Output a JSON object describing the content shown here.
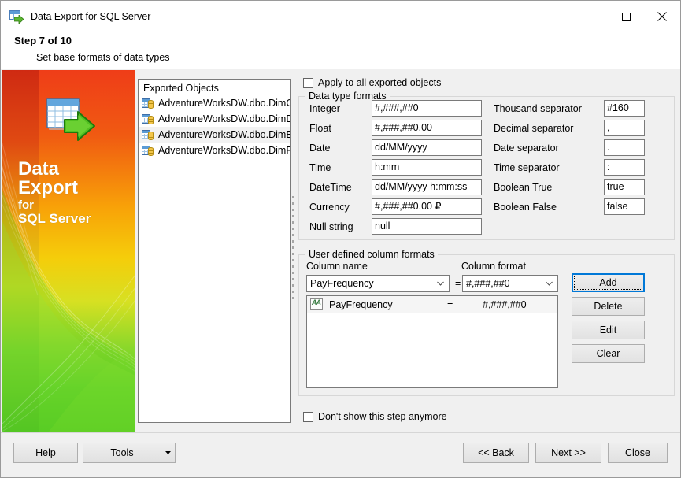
{
  "window": {
    "title": "Data Export for SQL Server",
    "icon": "data-export-icon",
    "minimize_label": "minimize-icon",
    "maximize_label": "maximize-icon",
    "close_label": "close-icon"
  },
  "header": {
    "step": "Step 7 of 10",
    "subtitle": "Set base formats of data types"
  },
  "banner": {
    "line1": "Data",
    "line2": "Export",
    "line3": "for",
    "line4": "SQL Server",
    "colors": {
      "top": "#e8361b",
      "mid": "#f5a800",
      "bottom": "#4cc417"
    }
  },
  "objects_list": {
    "header": "Exported Objects",
    "items": [
      {
        "label": "AdventureWorksDW.dbo.DimC",
        "selected": false
      },
      {
        "label": "AdventureWorksDW.dbo.DimD",
        "selected": false
      },
      {
        "label": "AdventureWorksDW.dbo.DimEn",
        "selected": true
      },
      {
        "label": "AdventureWorksDW.dbo.DimP",
        "selected": false
      }
    ]
  },
  "apply_all": {
    "label": "Apply to all exported objects",
    "checked": false
  },
  "data_type_formats": {
    "group_title": "Data type formats",
    "left_fields": [
      {
        "label": "Integer",
        "value": "#,###,##0"
      },
      {
        "label": "Float",
        "value": "#,###,##0.00"
      },
      {
        "label": "Date",
        "value": "dd/MM/yyyy"
      },
      {
        "label": "Time",
        "value": "h:mm"
      },
      {
        "label": "DateTime",
        "value": "dd/MM/yyyy h:mm:ss"
      },
      {
        "label": "Currency",
        "value": "#,###,##0.00 ₽"
      },
      {
        "label": "Null string",
        "value": "null"
      }
    ],
    "right_fields": [
      {
        "label": "Thousand separator",
        "value": "#160"
      },
      {
        "label": "Decimal separator",
        "value": ","
      },
      {
        "label": "Date separator",
        "value": "."
      },
      {
        "label": "Time separator",
        "value": ":"
      },
      {
        "label": "Boolean True",
        "value": "true"
      },
      {
        "label": "Boolean False",
        "value": "false"
      }
    ]
  },
  "user_formats": {
    "group_title": "User defined column formats",
    "column_name_label": "Column name",
    "column_format_label": "Column format",
    "column_name_value": "PayFrequency",
    "equals": "=",
    "column_format_value": "#,###,##0",
    "rows": [
      {
        "name": "PayFrequency",
        "eq": "=",
        "format": "#,###,##0"
      }
    ],
    "buttons": [
      {
        "label": "Add",
        "focused": true
      },
      {
        "label": "Delete",
        "focused": false
      },
      {
        "label": "Edit",
        "focused": false
      },
      {
        "label": "Clear",
        "focused": false
      }
    ]
  },
  "dont_show": {
    "label": "Don't show this step anymore",
    "checked": false
  },
  "footer": {
    "help": "Help",
    "tools": "Tools",
    "back": "<< Back",
    "next": "Next >>",
    "close": "Close"
  }
}
